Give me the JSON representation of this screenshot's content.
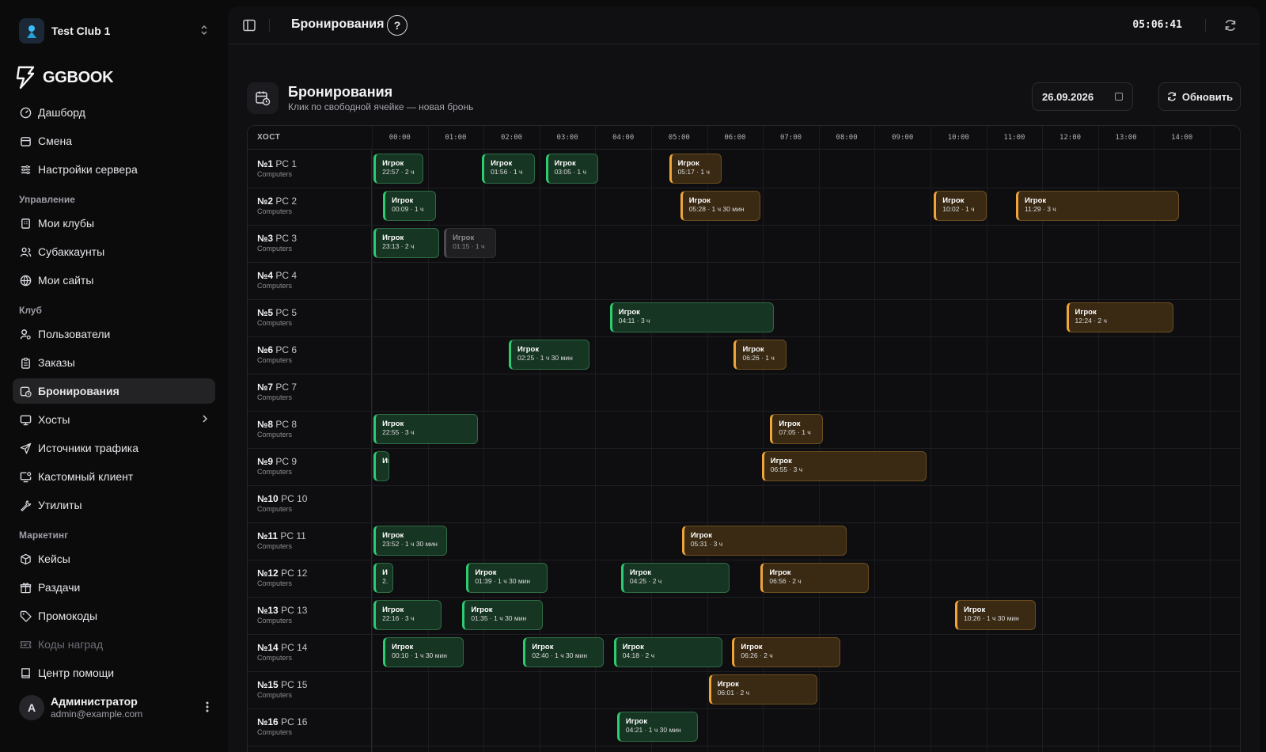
{
  "club": {
    "name": "Test Club 1"
  },
  "logo": {
    "text": "GGBOOK"
  },
  "nav": {
    "top": [
      {
        "key": "dashboard",
        "label": "Дашборд",
        "icon": "gauge-icon"
      },
      {
        "key": "shift",
        "label": "Смена",
        "icon": "calendar-icon"
      },
      {
        "key": "server-settings",
        "label": "Настройки сервера",
        "icon": "sliders-icon"
      }
    ],
    "groups": {
      "manage": "Управление",
      "club": "Клуб",
      "marketing": "Маркетинг"
    },
    "manage": [
      {
        "key": "my-clubs",
        "label": "Мои клубы",
        "icon": "building-icon"
      },
      {
        "key": "subaccounts",
        "label": "Субаккаунты",
        "icon": "users-icon"
      },
      {
        "key": "my-sites",
        "label": "Мои сайты",
        "icon": "globe-icon"
      }
    ],
    "club": [
      {
        "key": "users",
        "label": "Пользователи",
        "icon": "user-search-icon"
      },
      {
        "key": "orders",
        "label": "Заказы",
        "icon": "clipboard-icon"
      },
      {
        "key": "bookings",
        "label": "Бронирования",
        "icon": "calendar-clock-icon"
      },
      {
        "key": "hosts",
        "label": "Хосты",
        "icon": "monitor-icon"
      },
      {
        "key": "traffic",
        "label": "Источники трафика",
        "icon": "send-icon"
      },
      {
        "key": "custom-client",
        "label": "Кастомный клиент",
        "icon": "screen-share-icon"
      },
      {
        "key": "utils",
        "label": "Утилиты",
        "icon": "wrench-icon"
      }
    ],
    "marketing": [
      {
        "key": "cases",
        "label": "Кейсы",
        "icon": "box-icon"
      },
      {
        "key": "giveaways",
        "label": "Раздачи",
        "icon": "gift-icon"
      },
      {
        "key": "promocodes",
        "label": "Промокоды",
        "icon": "tag-icon"
      },
      {
        "key": "reward-codes",
        "label": "Коды наград",
        "icon": "ticket-icon"
      },
      {
        "key": "help",
        "label": "Центр помощи",
        "icon": "book-icon"
      }
    ]
  },
  "user": {
    "initial": "A",
    "name": "Администратор",
    "email": "admin@example.com"
  },
  "topbar": {
    "title": "Бронирования",
    "help": "?",
    "clock": "05:06:41"
  },
  "page": {
    "title": "Бронирования",
    "subtitle": "Клик по свободной ячейке — новая бронь",
    "date": "26.09.2026",
    "refresh_label": "Обновить"
  },
  "grid": {
    "host_header": "ХОСТ",
    "hours": [
      "00:00",
      "01:00",
      "02:00",
      "03:00",
      "04:00",
      "05:00",
      "06:00",
      "07:00",
      "08:00",
      "09:00",
      "10:00",
      "11:00",
      "12:00",
      "13:00",
      "14:00"
    ],
    "hosts": [
      {
        "num": "№1",
        "name": "PC 1",
        "type": "Computers"
      },
      {
        "num": "№2",
        "name": "PC 2",
        "type": "Computers"
      },
      {
        "num": "№3",
        "name": "PC 3",
        "type": "Computers"
      },
      {
        "num": "№4",
        "name": "PC 4",
        "type": "Computers"
      },
      {
        "num": "№5",
        "name": "PC 5",
        "type": "Computers"
      },
      {
        "num": "№6",
        "name": "PC 6",
        "type": "Computers"
      },
      {
        "num": "№7",
        "name": "PC 7",
        "type": "Computers"
      },
      {
        "num": "№8",
        "name": "PC 8",
        "type": "Computers"
      },
      {
        "num": "№9",
        "name": "PC 9",
        "type": "Computers"
      },
      {
        "num": "№10",
        "name": "PC 10",
        "type": "Computers"
      },
      {
        "num": "№11",
        "name": "PC 11",
        "type": "Computers"
      },
      {
        "num": "№12",
        "name": "PC 12",
        "type": "Computers"
      },
      {
        "num": "№13",
        "name": "PC 13",
        "type": "Computers"
      },
      {
        "num": "№14",
        "name": "PC 14",
        "type": "Computers"
      },
      {
        "num": "№15",
        "name": "PC 15",
        "type": "Computers"
      },
      {
        "num": "№16",
        "name": "PC 16",
        "type": "Computers"
      }
    ],
    "bookings": [
      {
        "row": 0,
        "start": 0.03,
        "end": 0.92,
        "status": "green",
        "name": "Игрок",
        "time": "22:57 · 2 ч"
      },
      {
        "row": 0,
        "start": 1.97,
        "end": 2.92,
        "status": "green",
        "name": "Игрок",
        "time": "01:56 · 1 ч"
      },
      {
        "row": 0,
        "start": 3.11,
        "end": 4.05,
        "status": "green",
        "name": "Игрок",
        "time": "03:05 · 1 ч"
      },
      {
        "row": 0,
        "start": 5.32,
        "end": 6.26,
        "status": "amber",
        "name": "Игрок",
        "time": "05:17 · 1 ч"
      },
      {
        "row": 1,
        "start": 0.2,
        "end": 1.15,
        "status": "green",
        "name": "Игрок",
        "time": "00:09 · 1 ч"
      },
      {
        "row": 1,
        "start": 5.52,
        "end": 6.96,
        "status": "amber",
        "name": "Игрок",
        "time": "05:28 · 1 ч 30 мин"
      },
      {
        "row": 1,
        "start": 10.06,
        "end": 11.0,
        "status": "amber",
        "name": "Игрок",
        "time": "10:02 · 1 ч"
      },
      {
        "row": 1,
        "start": 11.53,
        "end": 14.45,
        "status": "amber",
        "name": "Игрок",
        "time": "11:29 · 3 ч"
      },
      {
        "row": 2,
        "start": 0.03,
        "end": 1.21,
        "status": "green",
        "name": "Игрок",
        "time": "23:13 · 2 ч"
      },
      {
        "row": 2,
        "start": 1.29,
        "end": 2.23,
        "status": "gray",
        "name": "Игрок",
        "time": "01:15 · 1 ч"
      },
      {
        "row": 4,
        "start": 4.26,
        "end": 7.2,
        "status": "green",
        "name": "Игрок",
        "time": "04:11 · 3 ч"
      },
      {
        "row": 4,
        "start": 12.43,
        "end": 14.35,
        "status": "amber",
        "name": "Игрок",
        "time": "12:24 · 2 ч"
      },
      {
        "row": 5,
        "start": 2.45,
        "end": 3.9,
        "status": "green",
        "name": "Игрок",
        "time": "02:25 · 1 ч 30 мин"
      },
      {
        "row": 5,
        "start": 6.48,
        "end": 7.42,
        "status": "amber",
        "name": "Игрок",
        "time": "06:26 · 1 ч"
      },
      {
        "row": 7,
        "start": 0.03,
        "end": 1.9,
        "status": "green",
        "name": "Игрок",
        "time": "22:55 · 3 ч"
      },
      {
        "row": 7,
        "start": 7.13,
        "end": 8.08,
        "status": "amber",
        "name": "Игрок",
        "time": "07:05 · 1 ч"
      },
      {
        "row": 8,
        "start": 0.03,
        "end": 0.3,
        "status": "green",
        "name": "Игрок",
        "time": ""
      },
      {
        "row": 8,
        "start": 6.98,
        "end": 9.93,
        "status": "amber",
        "name": "Игрок",
        "time": "06:55 · 3 ч"
      },
      {
        "row": 10,
        "start": 0.03,
        "end": 1.35,
        "status": "green",
        "name": "Игрок",
        "time": "23:52 · 1 ч 30 мин"
      },
      {
        "row": 10,
        "start": 5.55,
        "end": 8.5,
        "status": "amber",
        "name": "Игрок",
        "time": "05:31 · 3 ч"
      },
      {
        "row": 11,
        "start": 0.03,
        "end": 0.38,
        "status": "green",
        "name": "И",
        "time": "2."
      },
      {
        "row": 11,
        "start": 1.69,
        "end": 3.14,
        "status": "green",
        "name": "Игрок",
        "time": "01:39 · 1 ч 30 мин"
      },
      {
        "row": 11,
        "start": 4.46,
        "end": 6.4,
        "status": "green",
        "name": "Игрок",
        "time": "04:25 · 2 ч"
      },
      {
        "row": 11,
        "start": 6.96,
        "end": 8.9,
        "status": "amber",
        "name": "Игрок",
        "time": "06:56 · 2 ч"
      },
      {
        "row": 12,
        "start": 0.03,
        "end": 1.25,
        "status": "green",
        "name": "Игрок",
        "time": "22:16 · 3 ч"
      },
      {
        "row": 12,
        "start": 1.62,
        "end": 3.06,
        "status": "green",
        "name": "Игрок",
        "time": "01:35 · 1 ч 30 мин"
      },
      {
        "row": 12,
        "start": 10.44,
        "end": 11.88,
        "status": "amber",
        "name": "Игрок",
        "time": "10:26 · 1 ч 30 мин"
      },
      {
        "row": 13,
        "start": 0.2,
        "end": 1.65,
        "status": "green",
        "name": "Игрок",
        "time": "00:10 · 1 ч 30 мин"
      },
      {
        "row": 13,
        "start": 2.71,
        "end": 4.15,
        "status": "green",
        "name": "Игрок",
        "time": "02:40 · 1 ч 30 мин"
      },
      {
        "row": 13,
        "start": 4.33,
        "end": 6.27,
        "status": "green",
        "name": "Игрок",
        "time": "04:18 · 2 ч"
      },
      {
        "row": 13,
        "start": 6.45,
        "end": 8.39,
        "status": "amber",
        "name": "Игрок",
        "time": "06:26 · 2 ч"
      },
      {
        "row": 14,
        "start": 6.03,
        "end": 7.97,
        "status": "amber",
        "name": "Игрок",
        "time": "06:01 · 2 ч"
      },
      {
        "row": 15,
        "start": 4.39,
        "end": 5.84,
        "status": "green",
        "name": "Игрок",
        "time": "04:21 · 1 ч 30 мин"
      }
    ]
  },
  "colors": {
    "green": "#2ecc71",
    "amber": "#f0a53a",
    "active_nav": "#232326"
  }
}
